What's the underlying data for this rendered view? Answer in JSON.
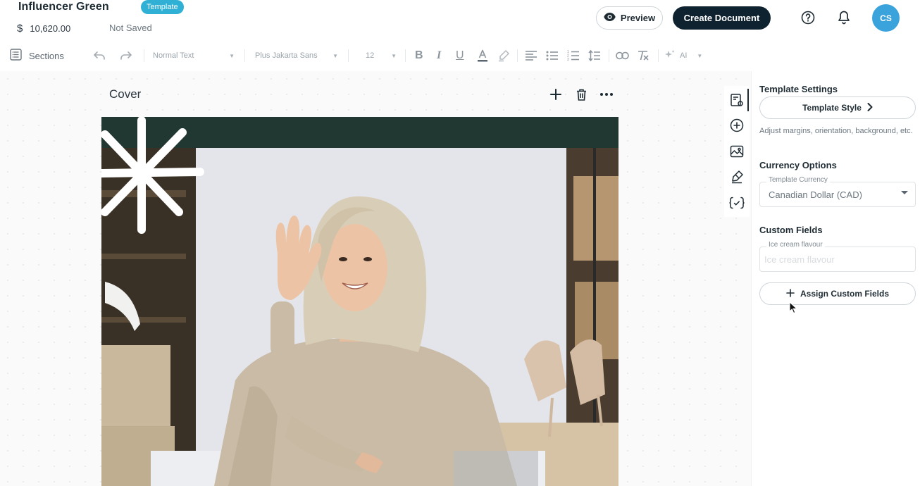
{
  "header": {
    "doc_title": "Influencer Green",
    "badge": "Template",
    "currency_symbol": "$",
    "amount": "10,620.00",
    "save_status": "Not Saved",
    "preview_label": "Preview",
    "create_label": "Create Document",
    "avatar_initials": "CS"
  },
  "toolbar": {
    "sections_label": "Sections",
    "text_style": "Normal Text",
    "font_family": "Plus Jakarta Sans",
    "font_size": "12",
    "ai_label": "AI"
  },
  "editor": {
    "section_title": "Cover"
  },
  "panel": {
    "template_settings_heading": "Template Settings",
    "template_style_button": "Template Style",
    "template_style_help": "Adjust margins, orientation, background, etc.",
    "currency_heading": "Currency Options",
    "currency_field_label": "Template Currency",
    "currency_value": "Canadian Dollar (CAD)",
    "custom_fields_heading": "Custom Fields",
    "custom_field_label": "Ice cream flavour",
    "custom_field_placeholder": "Ice cream flavour",
    "assign_button": "Assign Custom Fields"
  },
  "colors": {
    "brand_dark": "#0f2230",
    "badge": "#2fb0d4",
    "avatar": "#3aa3dc",
    "cover_band": "#213732"
  },
  "icons": {
    "preview": "eye-icon",
    "help": "help-circle-icon",
    "notifications": "bell-icon",
    "sections": "sections-list-icon",
    "undo": "undo-icon",
    "redo": "redo-icon",
    "rail": [
      "template-settings-icon",
      "add-block-icon",
      "image-icon",
      "signature-icon",
      "variables-icon"
    ]
  }
}
